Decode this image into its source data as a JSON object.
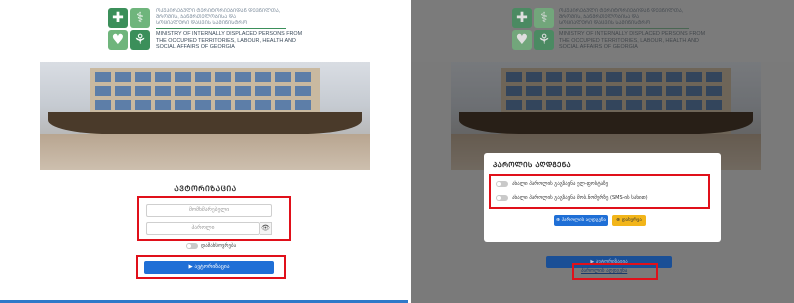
{
  "left": {
    "header": {
      "geo_lines": [
        "ᲝᲙᲣᲞᲘᲠᲔᲑᲣᲚᲘ ᲢᲔᲠᲘᲢᲝᲠᲘᲔᲑᲘᲓᲐᲜ ᲓᲔᲕᲜᲘᲚᲗᲐ,",
        "ᲨᲠᲝᲛᲘᲡ, ᲯᲐᲜᲛᲠᲗᲔᲚᲝᲑᲘᲡᲐ ᲓᲐ",
        "ᲡᲝᲪᲘᲐᲚᲣᲠᲘ ᲓᲐᲪᲕᲘᲡ ᲡᲐᲛᲘᲜᲘᲡᲢᲠᲝ"
      ],
      "en_lines": [
        "MINISTRY OF INTERNALLY DISPLACED PERSONS FROM",
        "THE OCCUPIED TERRITORIES, LABOUR, HEALTH AND",
        "SOCIAL AFFAIRS OF GEORGIA"
      ]
    },
    "auth_title": "ᲐᲕᲢᲝᲠᲘᲖᲐᲪᲘᲐ",
    "username_placeholder": "მომხმარებელი",
    "password_placeholder": "პაროლი",
    "eye_icon": "👁",
    "remember_label": "დამახსოვრება",
    "login_button": "▶ ავტორიზაცია"
  },
  "right": {
    "header": {
      "geo_lines": [
        "ᲝᲙᲣᲞᲘᲠᲔᲑᲣᲚᲘ ᲢᲔᲠᲘᲢᲝᲠᲘᲔᲑᲘᲓᲐᲜ ᲓᲔᲕᲜᲘᲚᲗᲐ,",
        "ᲨᲠᲝᲛᲘᲡ, ᲯᲐᲜᲛᲠᲗᲔᲚᲝᲑᲘᲡᲐ ᲓᲐ",
        "ᲡᲝᲪᲘᲐᲚᲣᲠᲘ ᲓᲐᲪᲕᲘᲡ ᲡᲐᲛᲘᲜᲘᲡᲢᲠᲝ"
      ],
      "en_lines": [
        "MINISTRY OF INTERNALLY DISPLACED PERSONS FROM",
        "THE OCCUPIED TERRITORIES, LABOUR, HEALTH AND",
        "SOCIAL AFFAIRS OF GEORGIA"
      ]
    },
    "modal": {
      "title": "ᲞᲐᲠᲝᲚᲘᲡ ᲐᲦᲓᲒᲔᲜᲐ",
      "option1": "ახალი პაროლის გაგზავნა ელ-ფოსტაზე",
      "option2": "ახალი პაროლის გაგზავნა მობ.ნომერზე (SMS-ის სახით)",
      "recover_button": "⊕ პაროლის აღდგენა",
      "cancel_button": "⊗ დახურვა"
    },
    "bg_login_button": "▶ ავტორიზაცია",
    "forgot_link": "პაროლის აღდგენა"
  },
  "colors": {
    "accent_blue": "#1f6fd6",
    "highlight_red": "#e0101a",
    "brand_green": "#3b8f5a",
    "warning_yellow": "#f2b51a"
  }
}
